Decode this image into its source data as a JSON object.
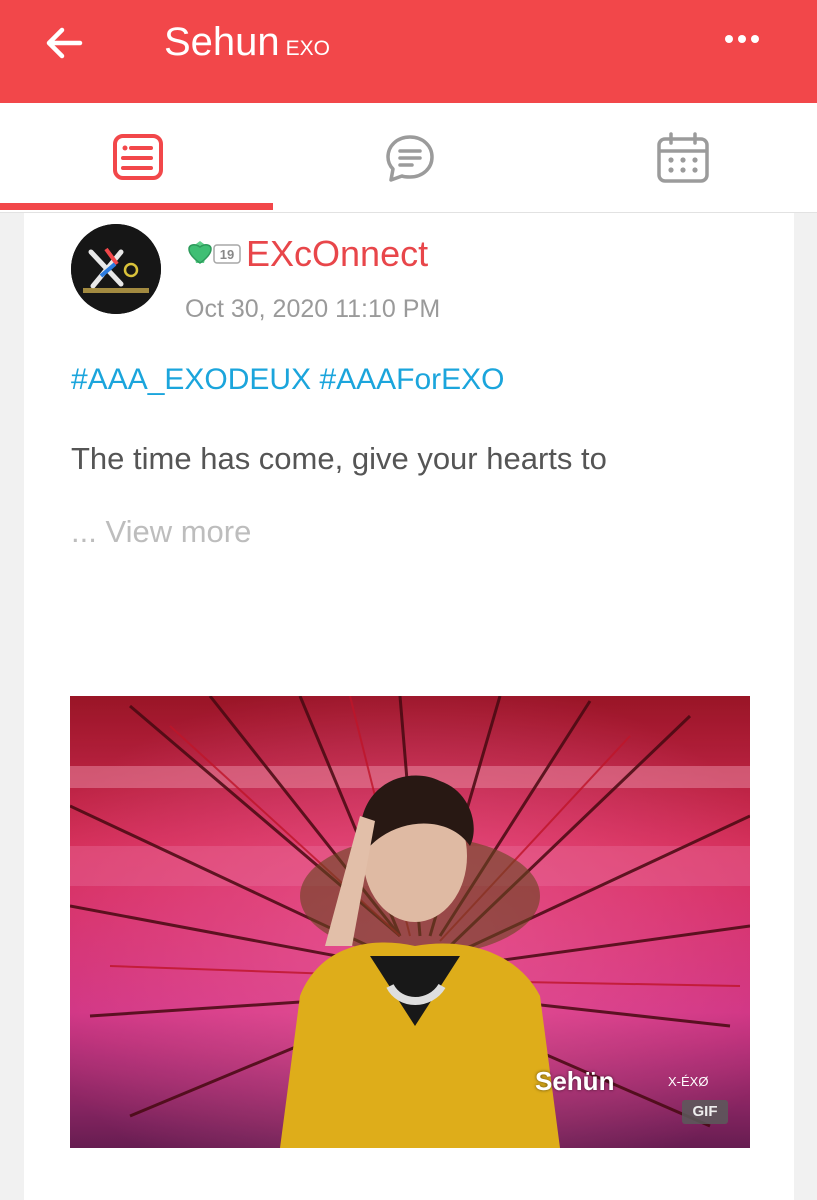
{
  "header": {
    "back_icon": "arrow-left-icon",
    "title": "Sehun",
    "subtitle": "EXO",
    "more_icon": "more-horizontal-icon",
    "color": "#f2474a"
  },
  "tabs": [
    {
      "name": "feed",
      "icon": "feed-list-icon",
      "active": true
    },
    {
      "name": "chat",
      "icon": "chat-bubble-icon",
      "active": false
    },
    {
      "name": "calendar",
      "icon": "calendar-icon",
      "active": false
    }
  ],
  "post": {
    "author": "EXcOnnect",
    "level": "19",
    "date": "Oct 30, 2020 11:10 PM",
    "tags": [
      "#AAA_EXODEUX",
      "#AAAForEXO"
    ],
    "body": "The time has come, give your hearts to",
    "view_more": "... View more",
    "media": {
      "caption_name": "Sehün",
      "caption_watermark": "X-ÉXØ",
      "type_badge": "GIF"
    },
    "tag_color": "#1ba5dc",
    "author_color": "#e8464a"
  }
}
